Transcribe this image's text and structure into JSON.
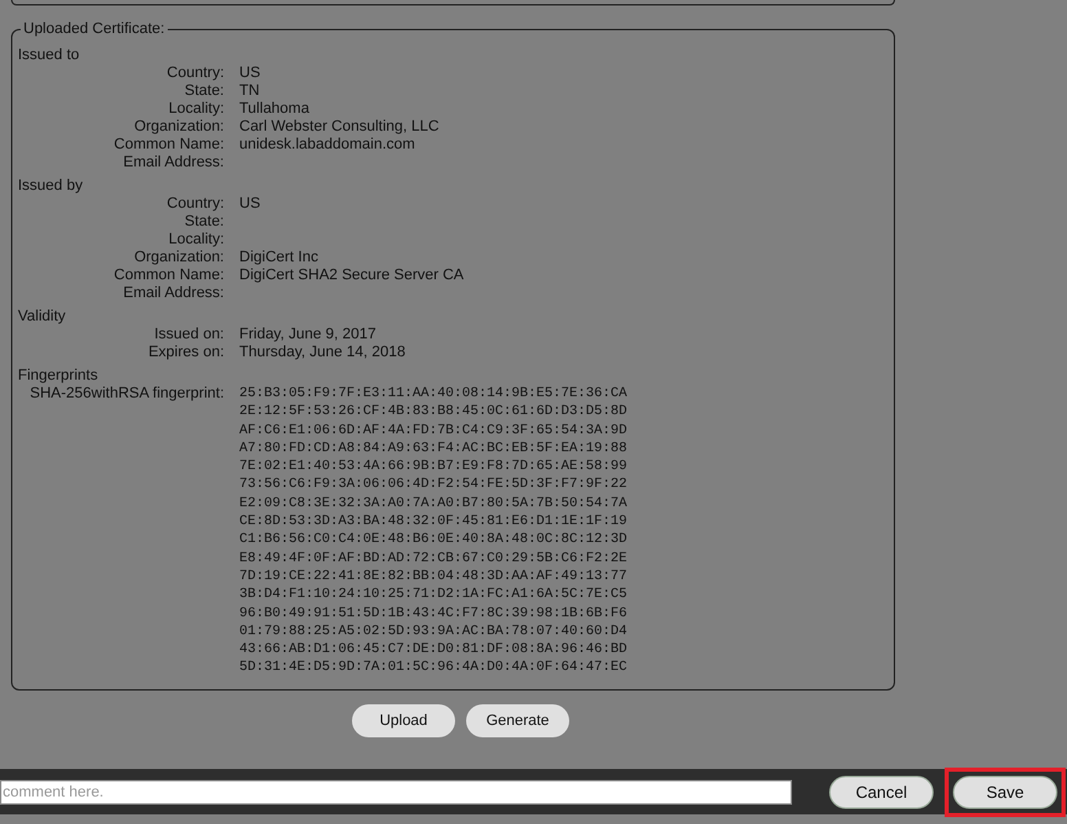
{
  "certificate": {
    "legend": "Uploaded Certificate:",
    "sections": [
      {
        "title": "Issued to",
        "fields": [
          {
            "label": "Country:",
            "value": "US"
          },
          {
            "label": "State:",
            "value": "TN"
          },
          {
            "label": "Locality:",
            "value": "Tullahoma"
          },
          {
            "label": "Organization:",
            "value": "Carl Webster Consulting, LLC"
          },
          {
            "label": "Common Name:",
            "value": "unidesk.labaddomain.com"
          },
          {
            "label": "Email Address:"
          }
        ]
      },
      {
        "title": "Issued by",
        "fields": [
          {
            "label": "Country:",
            "value": "US"
          },
          {
            "label": "State:"
          },
          {
            "label": "Locality:"
          },
          {
            "label": "Organization:",
            "value": "DigiCert Inc"
          },
          {
            "label": "Common Name:",
            "value": "DigiCert SHA2 Secure Server CA"
          },
          {
            "label": "Email Address:"
          }
        ]
      },
      {
        "title": "Validity",
        "fields": [
          {
            "label": "Issued on:",
            "value": "Friday, June 9, 2017"
          },
          {
            "label": "Expires on:",
            "value": "Thursday, June 14, 2018"
          }
        ]
      }
    ],
    "fingerprints": {
      "title": "Fingerprints",
      "label": "SHA-256withRSA fingerprint:",
      "lines": [
        "25:B3:05:F9:7F:E3:11:AA:40:08:14:9B:E5:7E:36:CA",
        "2E:12:5F:53:26:CF:4B:83:B8:45:0C:61:6D:D3:D5:8D",
        "AF:C6:E1:06:6D:AF:4A:FD:7B:C4:C9:3F:65:54:3A:9D",
        "A7:80:FD:CD:A8:84:A9:63:F4:AC:BC:EB:5F:EA:19:88",
        "7E:02:E1:40:53:4A:66:9B:B7:E9:F8:7D:65:AE:58:99",
        "73:56:C6:F9:3A:06:06:4D:F2:54:FE:5D:3F:F7:9F:22",
        "E2:09:C8:3E:32:3A:A0:7A:A0:B7:80:5A:7B:50:54:7A",
        "CE:8D:53:3D:A3:BA:48:32:0F:45:81:E6:D1:1E:1F:19",
        "C1:B6:56:C0:C4:0E:48:B6:0E:40:8A:48:0C:8C:12:3D",
        "E8:49:4F:0F:AF:BD:AD:72:CB:67:C0:29:5B:C6:F2:2E",
        "7D:19:CE:22:41:8E:82:BB:04:48:3D:AA:AF:49:13:77",
        "3B:D4:F1:10:24:10:25:71:D2:1A:FC:A1:6A:5C:7E:C5",
        "96:B0:49:91:51:5D:1B:43:4C:F7:8C:39:98:1B:6B:F6",
        "01:79:88:25:A5:02:5D:93:9A:AC:BA:78:07:40:60:D4",
        "43:66:AB:D1:06:45:C7:DE:D0:81:DF:08:8A:96:46:BD",
        "5D:31:4E:D5:9D:7A:01:5C:96:4A:D0:4A:0F:64:47:EC"
      ]
    }
  },
  "cert_buttons": [
    "Upload",
    "Generate"
  ],
  "footer": {
    "comment": {
      "placeholder": "comment here."
    },
    "buttons": [
      {
        "label": "Cancel",
        "highlighted": false
      },
      {
        "label": "Save",
        "highlighted": true
      }
    ]
  }
}
